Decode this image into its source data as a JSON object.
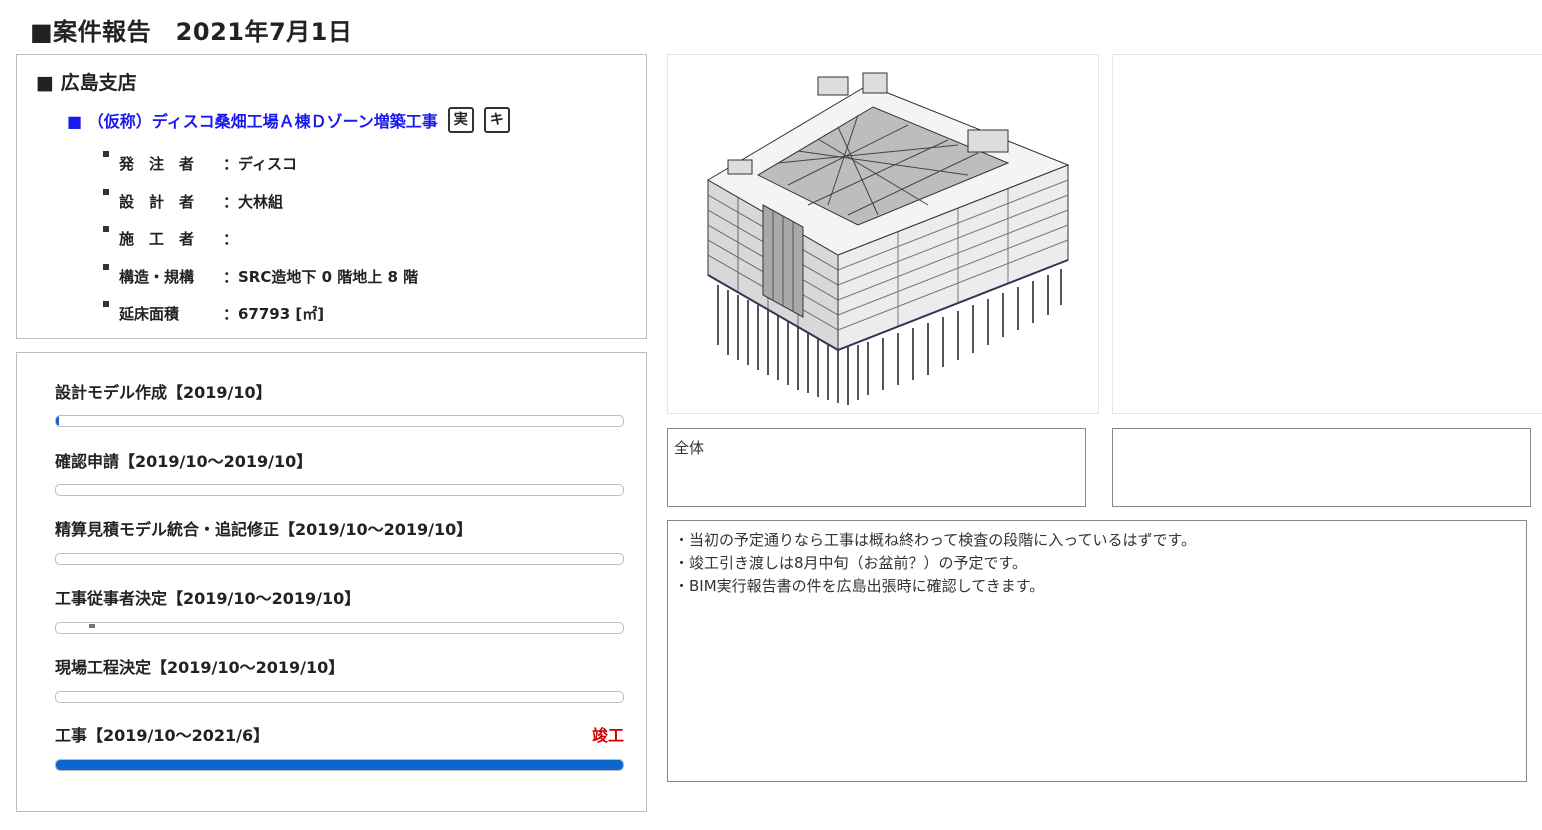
{
  "header": {
    "title": "■案件報告　2021年7月1日"
  },
  "branch": {
    "name": "■ 広島支店"
  },
  "project": {
    "title": "■ （仮称）ディスコ桑畑工場Ａ棟Ｄゾーン増築工事",
    "badge_jitsu": "実",
    "badge_ki": "キ",
    "details": [
      {
        "key": "発　注　者",
        "value": "：ディスコ"
      },
      {
        "key": "設　計　者",
        "value": "：大林組"
      },
      {
        "key": "施　工　者",
        "value": "："
      },
      {
        "key": "構造・規構",
        "value": "：SRC造地下 0 階地上 8 階"
      },
      {
        "key": "延床面積　",
        "value": "：67793 [㎡]"
      }
    ]
  },
  "phases": [
    {
      "label": "設計モデル作成【2019/10】",
      "status": "",
      "progress": 0.003
    },
    {
      "label": "確認申請【2019/10～2019/10】",
      "status": "",
      "progress": 0
    },
    {
      "label": "精算見積モデル統合・追記修正【2019/10～2019/10】",
      "status": "",
      "progress": 0
    },
    {
      "label": "工事従事者決定【2019/10～2019/10】",
      "status": "",
      "progress": 0
    },
    {
      "label": "現場工程決定【2019/10～2019/10】",
      "status": "",
      "progress": 0
    },
    {
      "label": "工事【2019/10～2021/6】",
      "status": "竣工",
      "progress": 1.0
    }
  ],
  "images": {
    "main_caption": "全体",
    "second_caption": ""
  },
  "comments": [
    "・当初の予定通りなら工事は概ね終わって検査の段階に入っているはずです。",
    "・竣工引き渡しは8月中旬（お盆前？）の予定です。",
    "・BIM実行報告書の件を広島出張時に確認してきます。"
  ],
  "colors": {
    "project_link": "#1a1aee",
    "status_done": "#d40000",
    "bar_fill": "#0a66cc"
  }
}
